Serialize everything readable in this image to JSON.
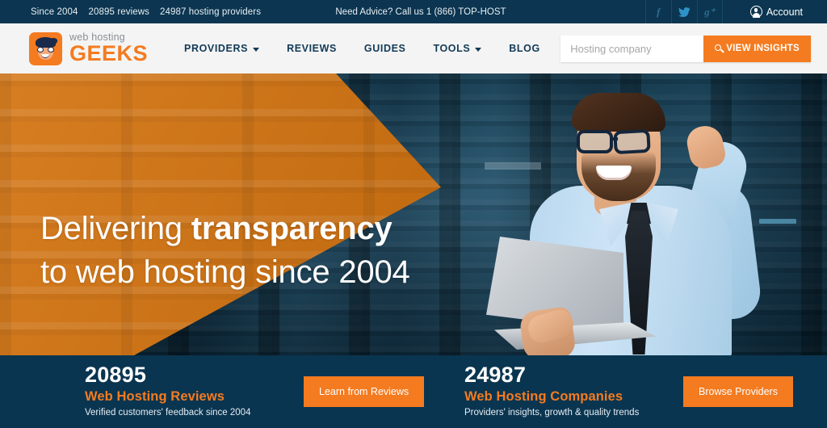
{
  "topbar": {
    "stats": [
      {
        "text": "Since 2004"
      },
      {
        "text": "20895 reviews"
      },
      {
        "text": "24987 hosting providers"
      }
    ],
    "advice": "Need Advice? Call us 1 (866) TOP-HOST",
    "social": [
      {
        "name": "facebook",
        "glyph": "f"
      },
      {
        "name": "twitter",
        "glyph": "ᵛ"
      },
      {
        "name": "google-plus",
        "glyph": "g⁺"
      }
    ],
    "account_label": "Account"
  },
  "header": {
    "logo": {
      "top": "web hosting",
      "bottom": "GEEKS"
    },
    "nav": [
      {
        "label": "PROVIDERS",
        "caret": true
      },
      {
        "label": "REVIEWS",
        "caret": false
      },
      {
        "label": "GUIDES",
        "caret": false
      },
      {
        "label": "TOOLS",
        "caret": true
      },
      {
        "label": "BLOG",
        "caret": false
      }
    ],
    "search": {
      "placeholder": "Hosting company",
      "value": "",
      "button_label": "VIEW INSIGHTS"
    }
  },
  "hero": {
    "headline_part1": "Delivering ",
    "headline_bold": "transparency",
    "headline_line2": "to web hosting since 2004",
    "image_alt": "smiling-man-with-laptop-in-datacenter"
  },
  "stats": [
    {
      "number": "20895",
      "label": "Web Hosting Reviews",
      "sub": "Verified customers' feedback since 2004",
      "button": "Learn from Reviews"
    },
    {
      "number": "24987",
      "label": "Web Hosting Companies",
      "sub": "Providers' insights, growth & quality trends",
      "button": "Browse Providers"
    }
  ],
  "colors": {
    "navy": "#0a3550",
    "navy_topbar": "#0b3550",
    "orange_brand": "#f47b20",
    "orange_hero": "#d4730f",
    "header_bg": "#f4f4f4",
    "nav_text": "#123a56"
  }
}
